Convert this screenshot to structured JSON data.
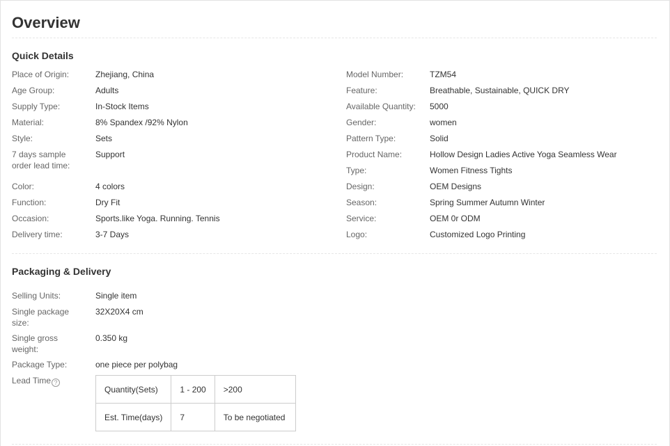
{
  "overview": {
    "title": "Overview"
  },
  "quick_details": {
    "heading": "Quick Details",
    "left": [
      {
        "label": "Place of Origin:",
        "value": "Zhejiang, China"
      },
      {
        "label": "Age Group:",
        "value": "Adults"
      },
      {
        "label": "Supply Type:",
        "value": "In-Stock Items"
      },
      {
        "label": "Material:",
        "value": "8% Spandex /92% Nylon"
      },
      {
        "label": "Style:",
        "value": "Sets"
      },
      {
        "label": "7 days sample order lead time:",
        "value": "Support"
      },
      {
        "label": "Color:",
        "value": "4 colors"
      },
      {
        "label": "Function:",
        "value": "Dry Fit"
      },
      {
        "label": "Occasion:",
        "value": "Sports.like Yoga. Running. Tennis"
      },
      {
        "label": "Delivery time:",
        "value": "3-7 Days"
      }
    ],
    "right": [
      {
        "label": "Model Number:",
        "value": "TZM54"
      },
      {
        "label": "Feature:",
        "value": "Breathable, Sustainable, QUICK DRY"
      },
      {
        "label": "Available Quantity:",
        "value": "5000"
      },
      {
        "label": "Gender:",
        "value": "women"
      },
      {
        "label": "Pattern Type:",
        "value": "Solid"
      },
      {
        "label": "Product Name:",
        "value": "Hollow Design Ladies Active Yoga Seamless Wear"
      },
      {
        "label": "Type:",
        "value": "Women Fitness Tights"
      },
      {
        "label": "Design:",
        "value": "OEM Designs"
      },
      {
        "label": "Season:",
        "value": "Spring Summer Autumn Winter"
      },
      {
        "label": "Service:",
        "value": "OEM 0r ODM"
      },
      {
        "label": "Logo:",
        "value": "Customized Logo Printing"
      }
    ]
  },
  "packaging": {
    "heading": "Packaging & Delivery",
    "rows": [
      {
        "label": "Selling Units:",
        "value": "Single item"
      },
      {
        "label": "Single package size:",
        "value": "32X20X4 cm"
      },
      {
        "label": "Single gross weight:",
        "value": "0.350 kg"
      },
      {
        "label": "Package Type:",
        "value": "one piece per polybag"
      }
    ],
    "lead_time": {
      "label": "Lead Time",
      "help_icon": "?",
      "table": [
        [
          "Quantity(Sets)",
          "1 - 200",
          ">200"
        ],
        [
          "Est. Time(days)",
          "7",
          "To be negotiated"
        ]
      ]
    }
  }
}
